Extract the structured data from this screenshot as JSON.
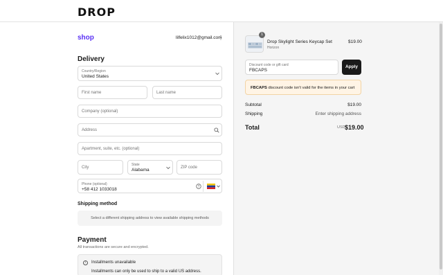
{
  "brand": {
    "logo": "DROP"
  },
  "account": {
    "shop_link": "shop",
    "email": "lilfelix1012@gmail.com",
    "menu_icon": "kebab-icon"
  },
  "delivery": {
    "title": "Delivery",
    "country": {
      "label": "Country/Region",
      "value": "United States"
    },
    "first_name": {
      "placeholder": "First name"
    },
    "last_name": {
      "placeholder": "Last name"
    },
    "company": {
      "placeholder": "Company (optional)"
    },
    "address": {
      "placeholder": "Address"
    },
    "apartment": {
      "placeholder": "Apartment, suite, etc. (optional)"
    },
    "city": {
      "placeholder": "City"
    },
    "state": {
      "label": "State",
      "value": "Alabama"
    },
    "zip": {
      "placeholder": "ZIP code"
    },
    "phone": {
      "label": "Phone (optional)",
      "value": "+58 412 1033018"
    }
  },
  "shipping": {
    "title": "Shipping method",
    "message": "Select a different shipping address to view available shipping methods"
  },
  "payment": {
    "title": "Payment",
    "subtitle": "All transactions are secure and encrypted.",
    "installments_title": "Installments unavailable",
    "installments_msg": "Installments can only be used to ship to a valid US address."
  },
  "summary": {
    "item": {
      "quantity": "1",
      "name": "Drop Skylight Series Keycap Set",
      "variant": "Horizon",
      "price": "$19.00"
    },
    "discount": {
      "label": "Discount code or gift card",
      "value": "FBCAPS",
      "apply_label": "Apply"
    },
    "warning": {
      "code": "FBCAPS",
      "message": " discount code isn't valid for the items in your cart"
    },
    "subtotal_label": "Subtotal",
    "subtotal_value": "$19.00",
    "shipping_label": "Shipping",
    "shipping_value": "Enter shipping address",
    "total_label": "Total",
    "currency": "USD",
    "total_value": "$19.00"
  },
  "colors": {
    "shop_accent": "#5a31f4",
    "apply_bg": "#1a1a1a",
    "warning_bg": "#fff4e5"
  }
}
